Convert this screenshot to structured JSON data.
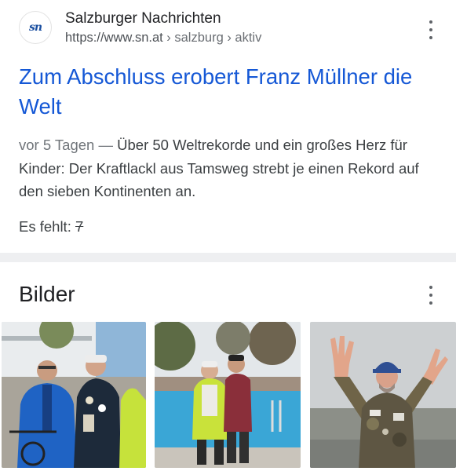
{
  "result": {
    "source_name": "Salzburger Nachrichten",
    "favicon_text": "sn",
    "url_base": "https://www.sn.at",
    "url_crumbs": " › salzburg › aktiv",
    "title": "Zum Abschluss erobert Franz Müllner die Welt",
    "date": "vor 5 Tagen",
    "dash": " — ",
    "snippet": "Über 50 Weltrekorde und ein großes Herz für Kinder: Der Kraftlackl aus Tamsweg strebt je einen Rekord auf den sieben Kontinenten an.",
    "missing_label": "Es fehlt: ",
    "missing_term": "7"
  },
  "images_section": {
    "title": "Bilder"
  },
  "icons": {
    "more": "more-vert-icon"
  }
}
